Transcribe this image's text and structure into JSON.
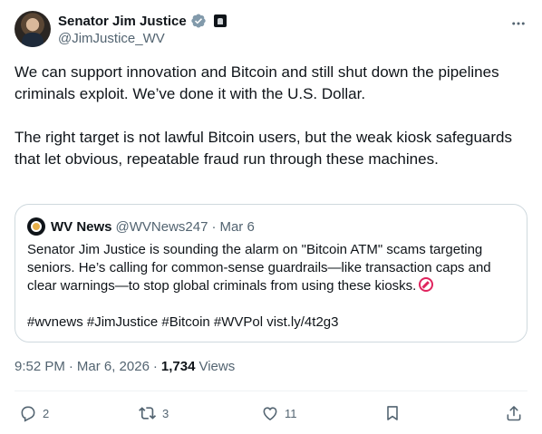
{
  "author": {
    "display_name": "Senator Jim Justice",
    "handle": "@JimJustice_WV"
  },
  "tweet": {
    "paragraph_1": "We can support innovation and Bitcoin and still shut down the pipelines criminals exploit. We’ve done it with the U.S. Dollar.",
    "paragraph_2": "The right target is not lawful Bitcoin users, but the weak kiosk safeguards that let obvious, repeatable fraud run through these machines."
  },
  "quote": {
    "name": "WV News",
    "handle": "@WVNews247",
    "separator": "·",
    "date": "Mar 6",
    "text": "Senator Jim Justice is sounding the alarm on \"Bitcoin ATM\" scams targeting seniors. He’s calling for common-sense guardrails—like transaction caps and clear warnings—to stop global criminals from using these kiosks.",
    "tags_line": "#wvnews #JimJustice #Bitcoin #WVPol vist.ly/4t2g3"
  },
  "meta": {
    "time": "9:52 PM",
    "date": "Mar 6, 2026",
    "separator": "·",
    "views_count": "1,734",
    "views_label": "Views"
  },
  "actions": {
    "replies": "2",
    "reposts": "3",
    "likes": "11"
  },
  "colors": {
    "text": "#0f1419",
    "secondary": "#536471",
    "verified": "#829aab",
    "border": "#cfd9de"
  },
  "icons": [
    "verified-badge-icon",
    "government-badge-icon",
    "more-icon",
    "reply-icon",
    "repost-icon",
    "like-icon",
    "bookmark-icon",
    "share-icon",
    "no-entry-emoji-icon"
  ]
}
